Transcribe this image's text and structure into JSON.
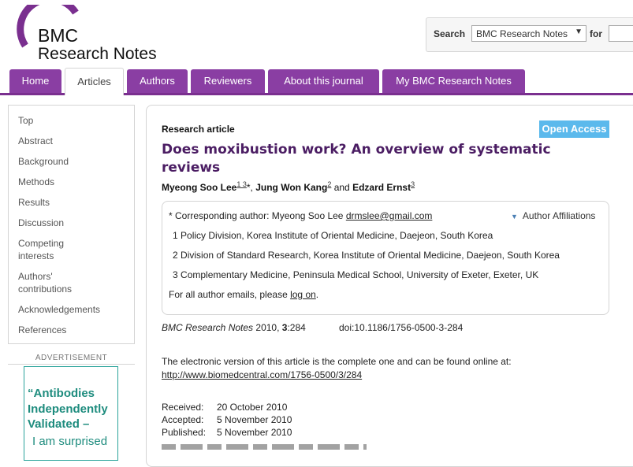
{
  "brand": {
    "line1": "BMC",
    "line2": "Research Notes",
    "arc_color": "#7a2f8f"
  },
  "search": {
    "label": "Search",
    "scope": "BMC Research Notes",
    "for_label": "for",
    "query": ""
  },
  "nav": {
    "tabs": [
      {
        "label": "Home"
      },
      {
        "label": "Articles",
        "active": true
      },
      {
        "label": "Authors"
      },
      {
        "label": "Reviewers"
      },
      {
        "label": "About this journal"
      },
      {
        "label": "My BMC Research Notes"
      }
    ],
    "tab_color": "#8a3ea3"
  },
  "sidebar": {
    "items": [
      {
        "label": "Top"
      },
      {
        "label": "Abstract"
      },
      {
        "label": "Background"
      },
      {
        "label": "Methods"
      },
      {
        "label": "Results"
      },
      {
        "label": "Discussion"
      },
      {
        "label": "Competing interests"
      },
      {
        "label": "Authors' contributions"
      },
      {
        "label": "Acknowledgements"
      },
      {
        "label": "References"
      }
    ],
    "ad_label": "ADVERTISEMENT",
    "ad": {
      "headline": "“Antibodies Independently Validated –",
      "sub": "I am surprised",
      "color": "#1e8c7e"
    }
  },
  "article": {
    "type": "Research article",
    "open_access": "Open Access",
    "title": "Does moxibustion work? An overview of systematic reviews",
    "authors": [
      {
        "name": "Myeong Soo Lee",
        "sup": "1 3",
        "corresponding": "*"
      },
      {
        "name": "Jung Won Kang",
        "sup": "2"
      },
      {
        "name": "Edzard Ernst",
        "sup": "3"
      }
    ],
    "author_separator": ",",
    "author_and": "and",
    "affiliations_box": {
      "corresponding_prefix": "* Corresponding author: Myeong Soo Lee",
      "email": "drmslee@gmail.com",
      "toggle_label": "Author Affiliations",
      "items": [
        {
          "num": "1",
          "text": "Policy Division, Korea Institute of Oriental Medicine, Daejeon, South Korea"
        },
        {
          "num": "2",
          "text": "Division of Standard Research, Korea Institute of Oriental Medicine, Daejeon, South Korea"
        },
        {
          "num": "3",
          "text": "Complementary Medicine, Peninsula Medical School, University of Exeter, Exeter, UK"
        }
      ],
      "emails_prefix": "For all author emails, please",
      "emails_link": "log on",
      "emails_suffix": "."
    },
    "citation": {
      "journal": "BMC Research Notes",
      "year": "2010,",
      "volume": "3",
      "pages": ":284",
      "doi": "doi:10.1186/1756-0500-3-284"
    },
    "electronic_note": "The electronic version of this article is the complete one and can be found online at:",
    "url": "http://www.biomedcentral.com/1756-0500/3/284",
    "dates": [
      {
        "label": "Received:",
        "value": "20 October 2010"
      },
      {
        "label": "Accepted:",
        "value": "5 November 2010"
      },
      {
        "label": "Published:",
        "value": "5 November 2010"
      }
    ],
    "title_color": "#4b1d63",
    "open_access_color": "#5bb9ec"
  }
}
